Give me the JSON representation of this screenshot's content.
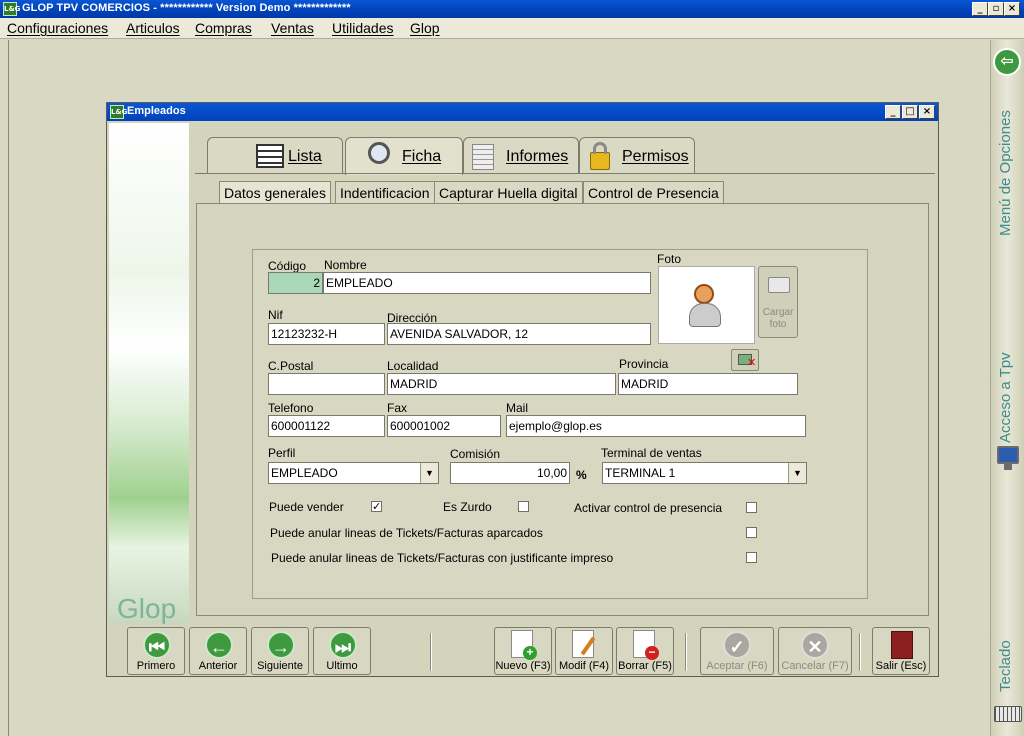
{
  "app": {
    "title": "GLOP TPV COMERCIOS - ************ Version Demo *************",
    "logo_text": "L&G",
    "controls": {
      "min": "_",
      "max": "▫",
      "close": "×"
    }
  },
  "menubar": [
    "Configuraciones",
    "Articulos",
    "Compras",
    "Ventas",
    "Utilidades",
    "Glop"
  ],
  "right_panel": {
    "menu_options": "Menú de Opciones",
    "tpv_access": "Acceso a Tpv",
    "keyboard": "Teclado"
  },
  "window": {
    "title": "Empleados",
    "logo_text": "L&G",
    "brand": "Glop",
    "controls": {
      "min": "_",
      "max": "□",
      "close": "×"
    }
  },
  "tabs": [
    "Lista",
    "Ficha",
    "Informes",
    "Permisos"
  ],
  "subtabs": [
    "Datos generales",
    "Indentificacion",
    "Capturar Huella digital",
    "Control de Presencia"
  ],
  "form": {
    "labels": {
      "codigo": "Código",
      "nombre": "Nombre",
      "foto": "Foto",
      "nif": "Nif",
      "direccion": "Dirección",
      "cpostal": "C.Postal",
      "localidad": "Localidad",
      "provincia": "Provincia",
      "telefono": "Telefono",
      "fax": "Fax",
      "mail": "Mail",
      "perfil": "Perfil",
      "comision": "Comisión",
      "terminal": "Terminal de ventas",
      "percent": "%"
    },
    "values": {
      "codigo": "2",
      "nombre": "EMPLEADO",
      "nif": "12123232-H",
      "direccion": "AVENIDA SALVADOR, 12",
      "cpostal": "",
      "localidad": "MADRID",
      "provincia": "MADRID",
      "telefono": "600001122",
      "fax": "600001002",
      "mail": "ejemplo@glop.es",
      "perfil": "EMPLEADO",
      "comision": "10,00",
      "terminal": "TERMINAL 1"
    },
    "cargar_foto": "Cargar foto",
    "checks": [
      {
        "label": "Puede vender",
        "checked": true
      },
      {
        "label": "Es Zurdo",
        "checked": false
      },
      {
        "label": "Activar control de presencia",
        "checked": false
      },
      {
        "label": "Puede anular lineas de Tickets/Facturas aparcados",
        "checked": false
      },
      {
        "label": "Puede anular lineas de Tickets/Facturas con justificante impreso",
        "checked": false
      }
    ]
  },
  "toolbar": {
    "primero": "Primero",
    "anterior": "Anterior",
    "siguiente": "Siguiente",
    "ultimo": "Ultimo",
    "nuevo": "Nuevo (F3)",
    "modif": "Modif (F4)",
    "borrar": "Borrar (F5)",
    "aceptar": "Aceptar (F6)",
    "cancelar": "Cancelar (F7)",
    "salir": "Salir (Esc)"
  },
  "colors": {
    "titlebar": "#0042b8",
    "accent_green": "#3f9a3f",
    "teal_text": "#3e8c8c"
  }
}
